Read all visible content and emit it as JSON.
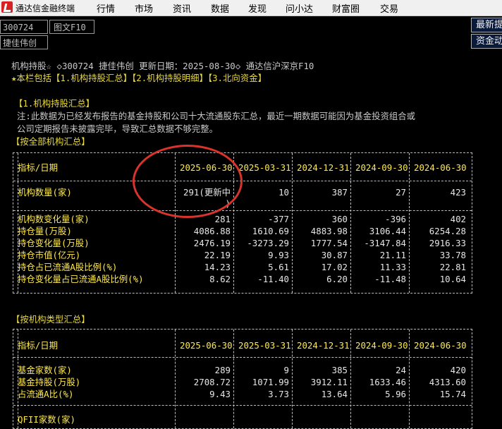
{
  "app": {
    "title": "通达信金融终端"
  },
  "menu": [
    "行情",
    "市场",
    "资讯",
    "数据",
    "发现",
    "问小达",
    "财富圈",
    "交易"
  ],
  "stock": {
    "code": "300724",
    "name": "捷佳伟创",
    "tab": "图文F10"
  },
  "right_buttons": [
    "最新提",
    "资金动"
  ],
  "header_line1": "机构持股☆ ◇300724 捷佳伟创 更新日期：2025-08-30◇ 通达信沪深京F10",
  "header_line2": "★本栏包括【1.机构持股汇总】【2.机构持股明细】【3.北向资金】",
  "section1_title": "【1.机构持股汇总】",
  "note_line1": "注:此数据为已经发布报告的基金持股和公司十大流通股东汇总，最近一期数据可能因为基金投资组合或",
  "note_line2": "公司定期报告未披露完毕，导致汇总数据不够完整。",
  "sub1_title": "【按全部机构汇总】",
  "table1": {
    "header_label": "指标/日期",
    "dates": [
      "2025-06-30",
      "2025-03-31",
      "2024-12-31",
      "2024-09-30",
      "2024-06-30"
    ],
    "row0": {
      "label": "机构数量(家)",
      "values": [
        "291(更新中",
        "10",
        "387",
        "27",
        "423"
      ],
      "cont": ")"
    },
    "rows": [
      {
        "label": "机构数变化量(家)",
        "values": [
          "281",
          "-377",
          "360",
          "-396",
          "402"
        ]
      },
      {
        "label": "持仓量(万股)",
        "values": [
          "4086.88",
          "1610.69",
          "4883.98",
          "3106.44",
          "6254.28"
        ]
      },
      {
        "label": "持仓变化量(万股)",
        "values": [
          "2476.19",
          "-3273.29",
          "1777.54",
          "-3147.84",
          "2916.33"
        ]
      },
      {
        "label": "持仓市值(亿元)",
        "values": [
          "22.19",
          "9.93",
          "30.87",
          "21.11",
          "33.78"
        ]
      },
      {
        "label": "持仓占已流通A股比例(%)",
        "values": [
          "14.23",
          "5.61",
          "17.02",
          "11.33",
          "22.81"
        ]
      },
      {
        "label": "持仓变化量占已流通A股比例(%)",
        "values": [
          "8.62",
          "-11.40",
          "6.20",
          "-11.48",
          "10.64"
        ]
      }
    ]
  },
  "sub2_title": "【按机构类型汇总】",
  "table2": {
    "header_label": "指标/日期",
    "dates": [
      "2025-06-30",
      "2025-03-31",
      "2024-12-31",
      "2024-09-30",
      "2024-06-30"
    ],
    "rows": [
      {
        "label": "基金家数(家)",
        "values": [
          "289",
          "9",
          "385",
          "24",
          "420"
        ]
      },
      {
        "label": "基金持股(万股)",
        "values": [
          "2708.72",
          "1071.99",
          "3912.11",
          "1633.46",
          "4313.60"
        ]
      },
      {
        "label": "占流通A比(%)",
        "values": [
          "9.43",
          "3.73",
          "13.64",
          "5.96",
          "15.74"
        ]
      }
    ],
    "partial_label": "QFII家数(家)"
  },
  "colors": {
    "label": "#ffe94a",
    "value": "#e6e6e6",
    "annotation": "#d8332c",
    "background": "#000000"
  }
}
